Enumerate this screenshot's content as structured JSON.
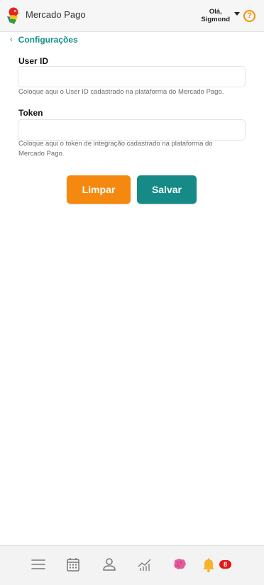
{
  "header": {
    "app_title": "Mercado Pago",
    "greeting_line1": "Olá,",
    "greeting_line2": "Sigmond",
    "help_symbol": "?"
  },
  "nav_back": {
    "chevron": "‹",
    "label": "Configurações"
  },
  "form": {
    "user_id": {
      "label": "User ID",
      "value": "",
      "placeholder": "",
      "help": "Coloque aqui o User ID cadastrado na plataforma do Mercado Pago."
    },
    "token": {
      "label": "Token",
      "value": "",
      "placeholder": "",
      "help": "Coloque aqui o token de integração cadastrado na plataforma do Mercado Pago."
    },
    "clear_button": "Limpar",
    "save_button": "Salvar"
  },
  "bottom_nav": {
    "items": [
      {
        "icon": "menu-icon"
      },
      {
        "icon": "calendar-icon"
      },
      {
        "icon": "person-icon"
      },
      {
        "icon": "chart-icon"
      },
      {
        "icon": "brain-icon"
      },
      {
        "icon": "bell-icon"
      }
    ],
    "notification_count": "8"
  },
  "colors": {
    "accent_teal": "#158a86",
    "accent_orange": "#f5890f",
    "badge_red": "#e01818"
  }
}
